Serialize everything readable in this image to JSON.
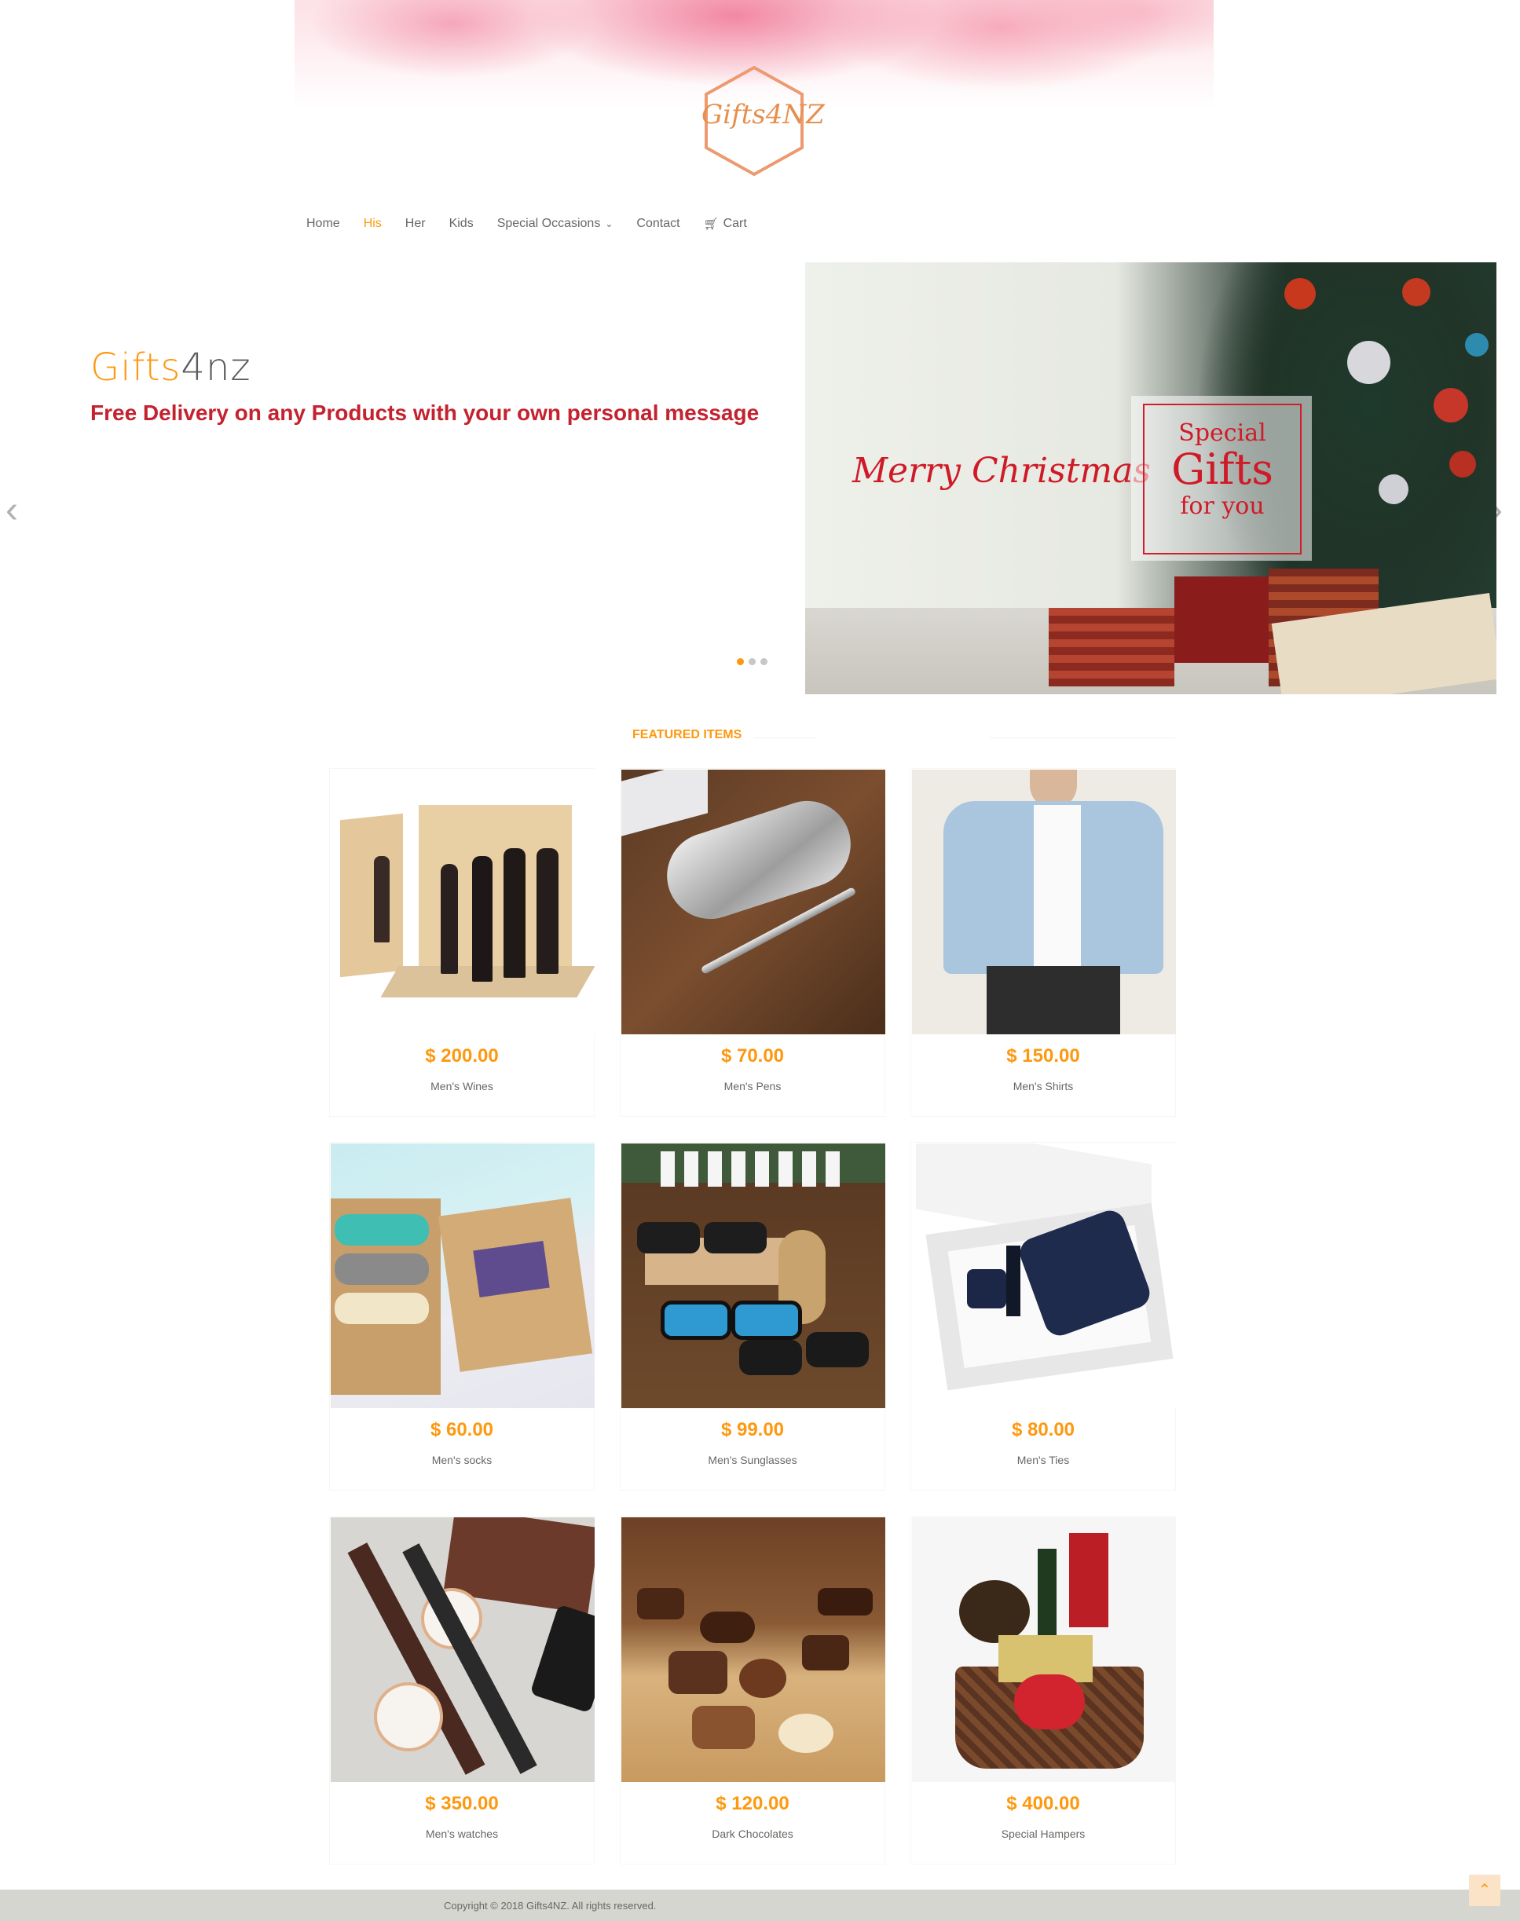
{
  "brand": {
    "logo_text": "Gifts4NZ",
    "accent_color": "#FE980F"
  },
  "nav": {
    "items": [
      {
        "label": "Home",
        "active": false
      },
      {
        "label": "His",
        "active": true
      },
      {
        "label": "Her",
        "active": false
      },
      {
        "label": "Kids",
        "active": false
      },
      {
        "label": "Special Occasions",
        "active": false,
        "has_dropdown": true
      },
      {
        "label": "Contact",
        "active": false
      },
      {
        "label": "Cart",
        "active": false,
        "icon": "cart-icon"
      }
    ]
  },
  "slider": {
    "brand_part1": "Gifts",
    "brand_part2": "4nz",
    "tagline": "Free Delivery on any Products with your own personal message",
    "slide_count": 3,
    "active_slide": 1,
    "image": {
      "merry": "Merry Christmas",
      "line1": "Special",
      "line2": "Gifts",
      "line3": "for you"
    }
  },
  "featured": {
    "title": "FEATURED ITEMS",
    "products": [
      {
        "price": "$ 200.00",
        "name": "Men's Wines"
      },
      {
        "price": "$ 70.00",
        "name": "Men's Pens"
      },
      {
        "price": "$ 150.00",
        "name": "Men's Shirts"
      },
      {
        "price": "$ 60.00",
        "name": "Men's socks"
      },
      {
        "price": "$ 99.00",
        "name": "Men's Sunglasses"
      },
      {
        "price": "$ 80.00",
        "name": "Men's Ties"
      },
      {
        "price": "$ 350.00",
        "name": "Men's watches"
      },
      {
        "price": "$ 120.00",
        "name": "Dark Chocolates"
      },
      {
        "price": "$ 400.00",
        "name": "Special Hampers"
      }
    ]
  },
  "footer": {
    "copyright": "Copyright © 2018 Gifts4NZ. All rights reserved."
  }
}
